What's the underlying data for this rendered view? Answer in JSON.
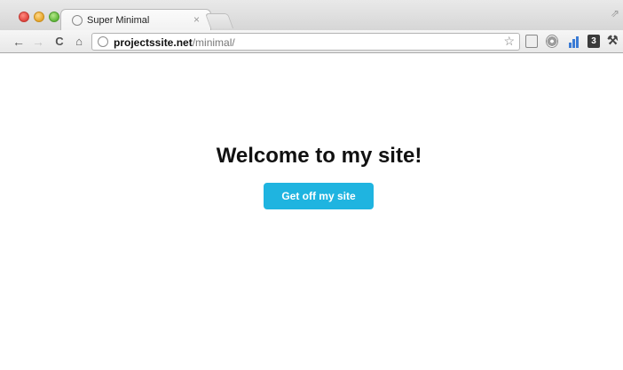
{
  "browser": {
    "tab": {
      "title": "Super Minimal",
      "close_glyph": "×",
      "favicon": "globe-icon"
    },
    "profile_glyph": "⇗",
    "toolbar": {
      "back_glyph": "←",
      "forward_glyph": "→",
      "reload_glyph": "C",
      "home_glyph": "⌂",
      "url_host": "projectssite.net",
      "url_path": "/minimal/",
      "star_glyph": "☆",
      "extension_4_label": "3",
      "wrench_glyph": "⚒"
    }
  },
  "page": {
    "heading": "Welcome to my site!",
    "button_label": "Get off my site"
  },
  "colors": {
    "accent_button": "#1fb4e0",
    "heading_text": "#111111",
    "page_background": "#ffffff"
  }
}
